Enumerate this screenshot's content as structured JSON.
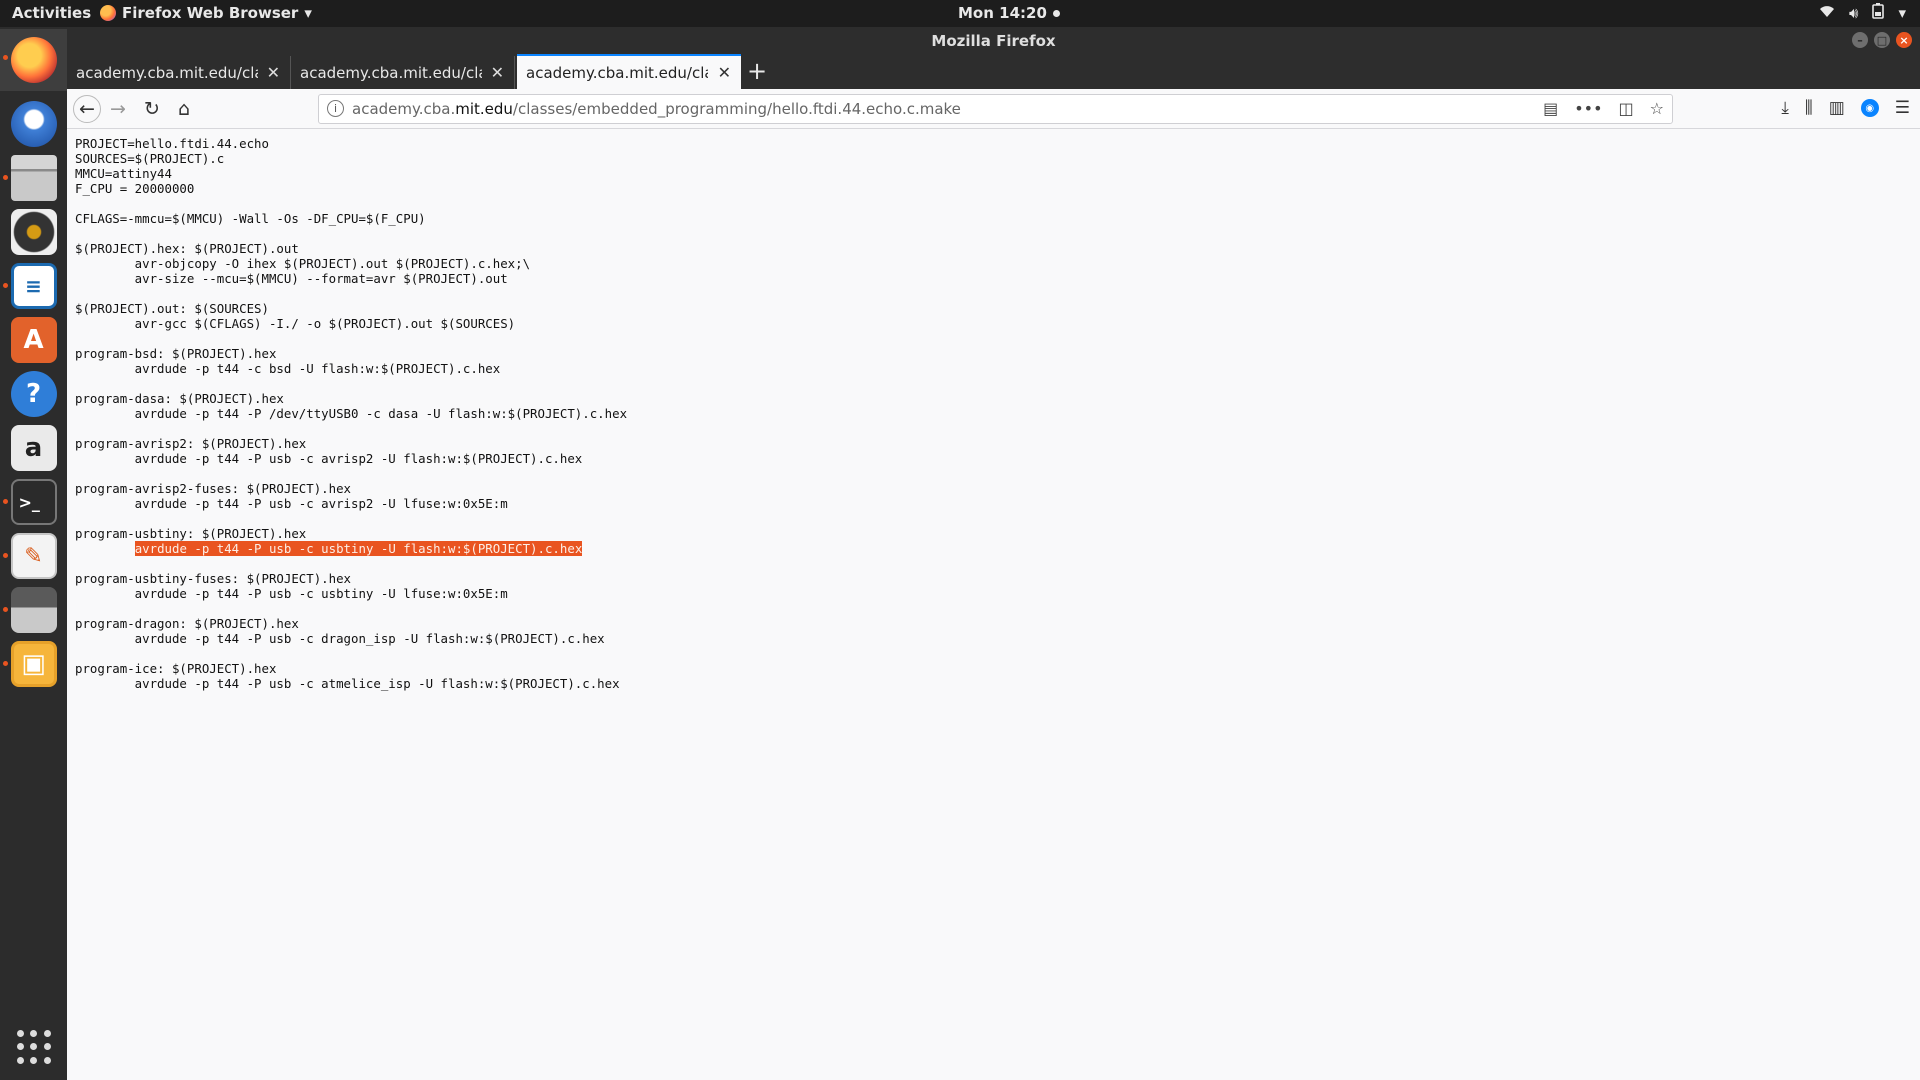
{
  "topbar": {
    "activities": "Activities",
    "app_menu": "Firefox Web Browser",
    "clock": "Mon 14:20"
  },
  "window": {
    "title": "Mozilla Firefox"
  },
  "tabs": [
    {
      "label": "academy.cba.mit.edu/classes/embedded_programming/"
    },
    {
      "label": "academy.cba.mit.edu/classes/embedded_programming/"
    },
    {
      "label": "academy.cba.mit.edu/classes/embedded_programming/"
    }
  ],
  "url": {
    "prefix": "academy.cba.",
    "host": "mit.edu",
    "path": "/classes/embedded_programming/hello.ftdi.44.echo.c.make"
  },
  "code_lines": [
    "PROJECT=hello.ftdi.44.echo",
    "SOURCES=$(PROJECT).c",
    "MMCU=attiny44",
    "F_CPU = 20000000",
    "",
    "CFLAGS=-mmcu=$(MMCU) -Wall -Os -DF_CPU=$(F_CPU)",
    "",
    "$(PROJECT).hex: $(PROJECT).out",
    "        avr-objcopy -O ihex $(PROJECT).out $(PROJECT).c.hex;\\",
    "        avr-size --mcu=$(MMCU) --format=avr $(PROJECT).out",
    "",
    "$(PROJECT).out: $(SOURCES)",
    "        avr-gcc $(CFLAGS) -I./ -o $(PROJECT).out $(SOURCES)",
    "",
    "program-bsd: $(PROJECT).hex",
    "        avrdude -p t44 -c bsd -U flash:w:$(PROJECT).c.hex",
    "",
    "program-dasa: $(PROJECT).hex",
    "        avrdude -p t44 -P /dev/ttyUSB0 -c dasa -U flash:w:$(PROJECT).c.hex",
    "",
    "program-avrisp2: $(PROJECT).hex",
    "        avrdude -p t44 -P usb -c avrisp2 -U flash:w:$(PROJECT).c.hex",
    "",
    "program-avrisp2-fuses: $(PROJECT).hex",
    "        avrdude -p t44 -P usb -c avrisp2 -U lfuse:w:0x5E:m",
    "",
    "program-usbtiny: $(PROJECT).hex",
    "        ",
    "",
    "program-usbtiny-fuses: $(PROJECT).hex",
    "        avrdude -p t44 -P usb -c usbtiny -U lfuse:w:0x5E:m",
    "",
    "program-dragon: $(PROJECT).hex",
    "        avrdude -p t44 -P usb -c dragon_isp -U flash:w:$(PROJECT).c.hex",
    "",
    "program-ice: $(PROJECT).hex",
    "        avrdude -p t44 -P usb -c atmelice_isp -U flash:w:$(PROJECT).c.hex"
  ],
  "highlighted_selection": "avrdude -p t44 -P usb -c usbtiny -U flash:w:$(PROJECT).c.hex",
  "colors": {
    "selection": "#e95420",
    "tab_accent": "#0a84ff"
  }
}
